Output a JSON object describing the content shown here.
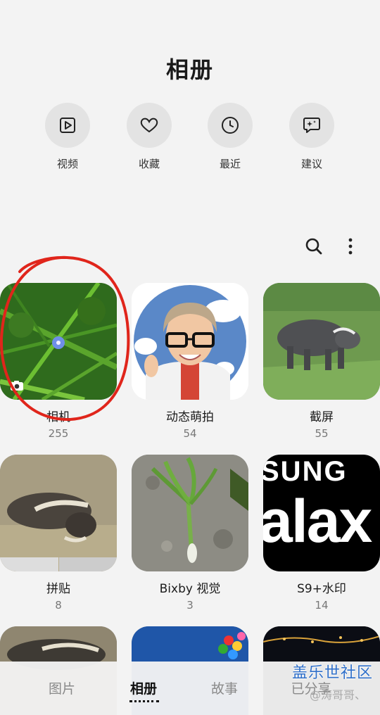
{
  "header": {
    "title": "相册"
  },
  "quick_actions": [
    {
      "label": "视频",
      "icon": "video-play-icon"
    },
    {
      "label": "收藏",
      "icon": "heart-icon"
    },
    {
      "label": "最近",
      "icon": "clock-icon"
    },
    {
      "label": "建议",
      "icon": "sparkle-chat-icon"
    }
  ],
  "toolbar": {
    "search_icon": "search-icon",
    "more_icon": "more-vertical-icon"
  },
  "albums": [
    {
      "name": "相机",
      "count": "255"
    },
    {
      "name": "动态萌拍",
      "count": "54"
    },
    {
      "name": "截屏",
      "count": "55"
    },
    {
      "name": "拼贴",
      "count": "8"
    },
    {
      "name": "Bixby 视觉",
      "count": "3"
    },
    {
      "name": "S9+水印",
      "count": "14"
    }
  ],
  "thumb_text": {
    "s9_top": "SUNG",
    "s9_big": "alax"
  },
  "bottom_nav": {
    "tabs": [
      {
        "label": "图片"
      },
      {
        "label": "相册",
        "active": true
      },
      {
        "label": "故事"
      },
      {
        "label": "已分享"
      }
    ]
  },
  "watermark": {
    "brand": "盖乐世社区",
    "user": "@涛哥哥、"
  },
  "colors": {
    "annotation_circle": "#e0251b",
    "watermark": "#2f6fc9"
  }
}
